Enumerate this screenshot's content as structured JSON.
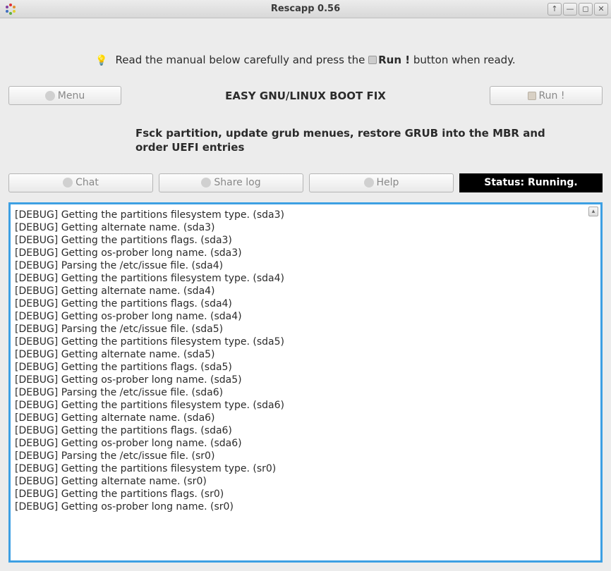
{
  "window": {
    "title": "Rescapp 0.56"
  },
  "instruction": {
    "prefix": "Read the manual below carefully and press the ",
    "run_label": "Run !",
    "suffix": " button when ready."
  },
  "top": {
    "menu_label": "Menu",
    "heading": "EASY GNU/LINUX BOOT FIX",
    "run_label": "Run !"
  },
  "description": "Fsck partition, update grub menues, restore GRUB into the MBR and order UEFI entries",
  "actions": {
    "chat_label": "Chat",
    "sharelog_label": "Share log",
    "help_label": "Help",
    "status_label": "Status: Running."
  },
  "log_lines": [
    "[DEBUG] Getting the partitions filesystem type. (sda3)",
    "[DEBUG] Getting alternate name. (sda3)",
    "[DEBUG] Getting the partitions flags. (sda3)",
    "[DEBUG] Getting os-prober long name. (sda3)",
    "[DEBUG] Parsing the /etc/issue file. (sda4)",
    "[DEBUG] Getting the partitions filesystem type. (sda4)",
    "[DEBUG] Getting alternate name. (sda4)",
    "[DEBUG] Getting the partitions flags. (sda4)",
    "[DEBUG] Getting os-prober long name. (sda4)",
    "[DEBUG] Parsing the /etc/issue file. (sda5)",
    "[DEBUG] Getting the partitions filesystem type. (sda5)",
    "[DEBUG] Getting alternate name. (sda5)",
    "[DEBUG] Getting the partitions flags. (sda5)",
    "[DEBUG] Getting os-prober long name. (sda5)",
    "[DEBUG] Parsing the /etc/issue file. (sda6)",
    "[DEBUG] Getting the partitions filesystem type. (sda6)",
    "[DEBUG] Getting alternate name. (sda6)",
    "[DEBUG] Getting the partitions flags. (sda6)",
    "[DEBUG] Getting os-prober long name. (sda6)",
    "[DEBUG] Parsing the /etc/issue file. (sr0)",
    "[DEBUG] Getting the partitions filesystem type. (sr0)",
    "[DEBUG] Getting alternate name. (sr0)",
    "[DEBUG] Getting the partitions flags. (sr0)",
    "[DEBUG] Getting os-prober long name. (sr0)"
  ]
}
